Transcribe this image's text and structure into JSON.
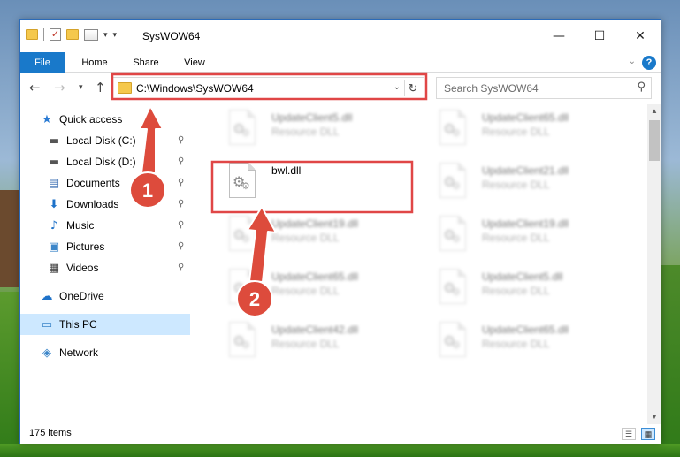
{
  "window": {
    "title": "SysWOW64"
  },
  "title_buttons": {
    "minimize": "—",
    "maximize": "☐",
    "close": "✕"
  },
  "ribbon": {
    "tabs": [
      "File",
      "Home",
      "Share",
      "View"
    ],
    "help": "?"
  },
  "navigation": {
    "back": "←",
    "forward": "→",
    "recent": "▾",
    "up": "↑",
    "address_path": "C:\\Windows\\SysWOW64",
    "refresh": "↻",
    "search_placeholder": "Search SysWOW64"
  },
  "sidebar": {
    "quick_access": {
      "label": "Quick access",
      "icon": "star-icon"
    },
    "pinned": [
      {
        "label": "Local Disk (C:)",
        "icon": "drive-icon"
      },
      {
        "label": "Local Disk (D:)",
        "icon": "drive-icon"
      },
      {
        "label": "Documents",
        "icon": "documents-icon"
      },
      {
        "label": "Downloads",
        "icon": "download-icon"
      },
      {
        "label": "Music",
        "icon": "music-icon"
      },
      {
        "label": "Pictures",
        "icon": "pictures-icon"
      },
      {
        "label": "Videos",
        "icon": "videos-icon"
      }
    ],
    "onedrive": "OneDrive",
    "this_pc": "This PC",
    "network": "Network"
  },
  "files": {
    "left": [
      {
        "name": "UpdateClient5.dll",
        "type": "Resource DLL"
      },
      {
        "name": "bwl.dll",
        "type": ""
      },
      {
        "name": "UpdateClient19.dll",
        "type": "Resource DLL"
      },
      {
        "name": "UpdateClient65.dll",
        "type": "Resource DLL"
      },
      {
        "name": "UpdateClient42.dll",
        "type": "Resource DLL"
      }
    ],
    "right": [
      {
        "name": "UpdateClient65.dll",
        "type": "Resource DLL"
      },
      {
        "name": "UpdateClient21.dll",
        "type": "Resource DLL"
      },
      {
        "name": "UpdateClient19.dll",
        "type": "Resource DLL"
      },
      {
        "name": "UpdateClient5.dll",
        "type": "Resource DLL"
      },
      {
        "name": "UpdateClient65.dll",
        "type": "Resource DLL"
      }
    ]
  },
  "status": {
    "item_count": "175 items"
  },
  "annotations": {
    "step1": "1",
    "step2": "2",
    "highlight_color": "#e04646",
    "badge_color": "#dd4b3c"
  },
  "colors": {
    "accent": "#1979ca",
    "selection": "#cde8ff"
  }
}
